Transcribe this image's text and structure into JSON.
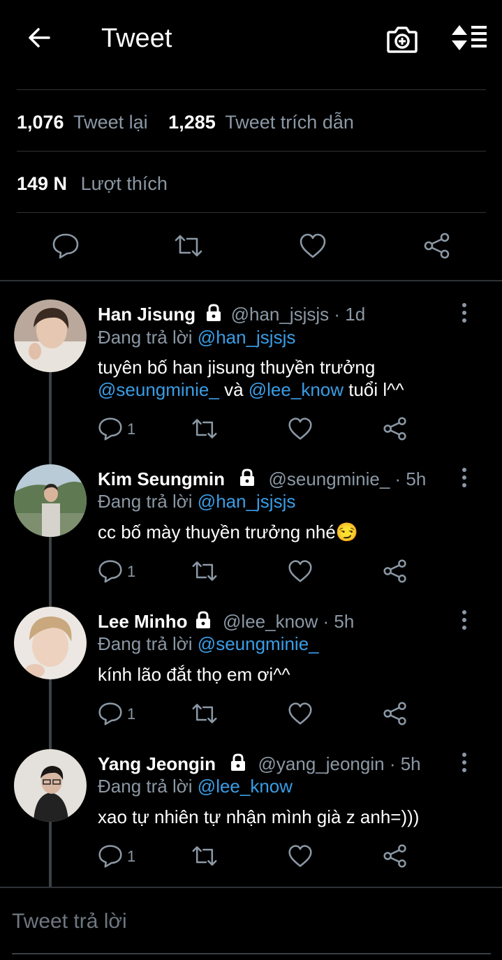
{
  "header": {
    "title": "Tweet",
    "back_icon": "arrow-left-icon",
    "camera_icon": "camera-plus-icon",
    "sort_icon": "sort-list-icon"
  },
  "stats": {
    "retweets_count": "1,076",
    "retweets_label": "Tweet lại",
    "quotes_count": "1,285",
    "quotes_label": "Tweet trích dẫn",
    "likes_count": "149 N",
    "likes_label": "Lượt thích"
  },
  "colors": {
    "background": "#000000",
    "muted": "#8b98a5",
    "accent": "#3a9de6",
    "divider": "#2f3336"
  },
  "replies": [
    {
      "name": "Han Jisung",
      "handle": "@han_jsjsjs",
      "time": "· 1d",
      "replying_label": "Đang trả lời",
      "replying_to": "@han_jsjsjs",
      "text_1": "tuyên bố han jisung thuyền trưởng",
      "mention_a": "@seungminie_",
      "connector": "và",
      "mention_b": "@lee_know",
      "text_2": "tuổi l^^",
      "reply_count": "1"
    },
    {
      "name": "Kim Seungmin",
      "handle": "@seungminie_",
      "time": "· 5h",
      "replying_label": "Đang trả lời",
      "replying_to": "@han_jsjsjs",
      "text": "cc bố mày thuyền trưởng nhé😏",
      "reply_count": "1"
    },
    {
      "name": "Lee Minho",
      "handle": "@lee_know",
      "time": "· 5h",
      "replying_label": "Đang trả lời",
      "replying_to": "@seungminie_",
      "text": "kính lão đắt thọ em ơi^^",
      "reply_count": "1"
    },
    {
      "name": "Yang Jeongin",
      "handle": "@yang_jeongin",
      "time": "· 5h",
      "replying_label": "Đang trả lời",
      "replying_to": "@lee_know",
      "text": "xao tự nhiên tự nhận mình già z anh=)))",
      "reply_count": "1"
    }
  ],
  "composer": {
    "placeholder": "Tweet trả lời"
  }
}
